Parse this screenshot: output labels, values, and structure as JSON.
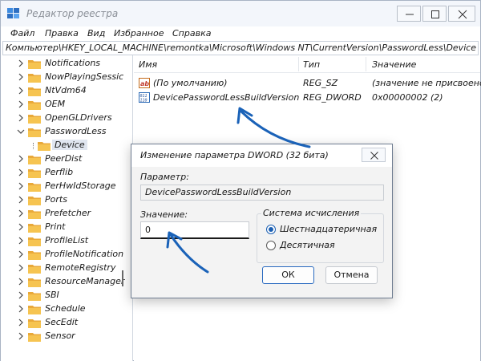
{
  "window": {
    "title": "Редактор реестра",
    "accent": "#1a62b8"
  },
  "menu": [
    "Файл",
    "Правка",
    "Вид",
    "Избранное",
    "Справка"
  ],
  "address": "Компьютер\\HKEY_LOCAL_MACHINE\\remontka\\Microsoft\\Windows NT\\CurrentVersion\\PasswordLess\\Device",
  "tree": {
    "items": [
      {
        "label": "Notifications",
        "icon": "folder-icon"
      },
      {
        "label": "NowPlayingSessic",
        "icon": "folder-icon"
      },
      {
        "label": "NtVdm64",
        "icon": "folder-icon"
      },
      {
        "label": "OEM",
        "icon": "folder-icon"
      },
      {
        "label": "OpenGLDrivers",
        "icon": "folder-icon"
      },
      {
        "label": "PasswordLess",
        "icon": "folder-icon",
        "expanded": true
      },
      {
        "label": "Device",
        "icon": "folder-icon",
        "selected": true
      },
      {
        "label": "PeerDist",
        "icon": "folder-icon"
      },
      {
        "label": "Perflib",
        "icon": "folder-icon"
      },
      {
        "label": "PerHwIdStorage",
        "icon": "folder-icon"
      },
      {
        "label": "Ports",
        "icon": "folder-icon"
      },
      {
        "label": "Prefetcher",
        "icon": "folder-icon"
      },
      {
        "label": "Print",
        "icon": "folder-icon"
      },
      {
        "label": "ProfileList",
        "icon": "folder-icon"
      },
      {
        "label": "ProfileNotification",
        "icon": "folder-icon"
      },
      {
        "label": "RemoteRegistry",
        "icon": "folder-icon"
      },
      {
        "label": "ResourceManager",
        "icon": "folder-icon"
      },
      {
        "label": "SBI",
        "icon": "folder-icon"
      },
      {
        "label": "Schedule",
        "icon": "folder-icon"
      },
      {
        "label": "SecEdit",
        "icon": "folder-icon"
      },
      {
        "label": "Sensor",
        "icon": "folder-icon"
      }
    ]
  },
  "list": {
    "headers": {
      "name": "Имя",
      "type": "Тип",
      "value": "Значение"
    },
    "rows": [
      {
        "name": "(По умолчанию)",
        "type": "REG_SZ",
        "value": "(значение не присвоено)",
        "icon": "string-value-icon"
      },
      {
        "name": "DevicePasswordLessBuildVersion",
        "type": "REG_DWORD",
        "value": "0x00000002 (2)",
        "icon": "binary-value-icon"
      }
    ]
  },
  "dialog": {
    "title": "Изменение параметра DWORD (32 бита)",
    "param_label": "Параметр:",
    "param_value": "DevicePasswordLessBuildVersion",
    "value_label": "Значение:",
    "value": "0",
    "radix_label": "Система исчисления",
    "radix_hex": "Шестнадцатеричная",
    "radix_dec": "Десятичная",
    "radix_selected": "hex",
    "ok": "ОК",
    "cancel": "Отмена"
  }
}
